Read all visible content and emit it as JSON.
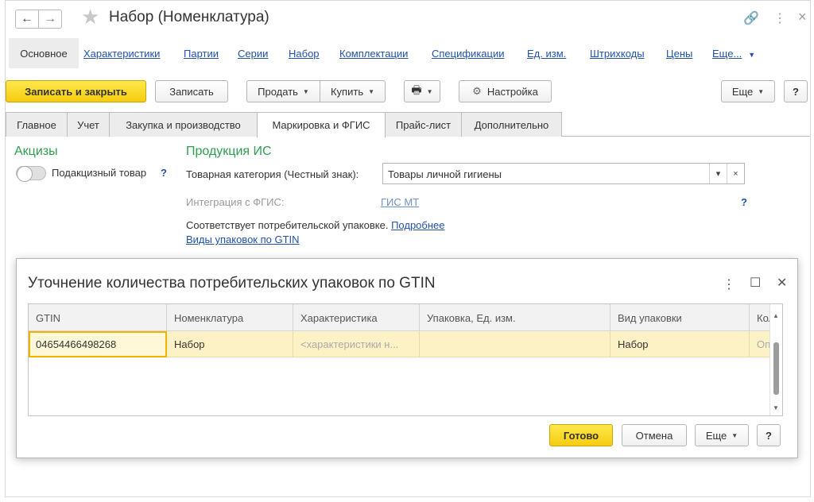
{
  "header": {
    "title": "Набор (Номенклатура)",
    "back_icon": "←",
    "forward_icon": "→",
    "star_icon": "★",
    "link_icon": "🔗",
    "more_icon": "⋮",
    "close_icon": "×"
  },
  "nav": {
    "main": "Основное",
    "links": [
      "Характеристики",
      "Партии",
      "Серии",
      "Набор",
      "Комплектации",
      "Спецификации",
      "Ед. изм.",
      "Штрихкоды",
      "Цены",
      "Еще..."
    ]
  },
  "toolbar": {
    "save_close": "Записать и закрыть",
    "save": "Записать",
    "sell": "Продать",
    "buy": "Купить",
    "print_icon": "🖶",
    "settings_icon": "⚙",
    "settings": "Настройка",
    "more": "Еще",
    "help": "?"
  },
  "tabs": [
    "Главное",
    "Учет",
    "Закупка и производство",
    "Маркировка и ФГИС",
    "Прайс-лист",
    "Дополнительно"
  ],
  "form": {
    "excise_title": "Акцизы",
    "excise_label": "Подакцизный товар",
    "excise_help": "?",
    "is_title": "Продукция ИС",
    "category_label": "Товарная категория (Честный знак):",
    "category_value": "Товары личной гигиены",
    "category_dd": "▾",
    "category_clear": "×",
    "fgis_label": "Интеграция с ФГИС:",
    "fgis_link": "ГИС МТ",
    "fgis_help": "?",
    "package_text": "Соответствует потребительской упаковке.",
    "package_more": "Подробнее",
    "gtin_link": "Виды упаковок по GTIN"
  },
  "dialog": {
    "title": "Уточнение количества потребительских упаковок по GTIN",
    "more_icon": "⋮",
    "max_icon": "☐",
    "close_icon": "✕",
    "columns": [
      "GTIN",
      "Номенклатура",
      "Характеристика",
      "Упаковка, Ед. изм.",
      "Вид упаковки",
      "Коли"
    ],
    "row": [
      "04654466498268",
      "Набор",
      "<характеристики н...",
      "",
      "Набор",
      "Опре"
    ],
    "ok": "Готово",
    "cancel": "Отмена",
    "more": "Еще",
    "help": "?"
  },
  "colors": {
    "accent_yellow": "#f5cc10",
    "link_blue": "#2151a8",
    "section_green": "#2e9e4e",
    "row_highlight": "#fcf2c5"
  }
}
